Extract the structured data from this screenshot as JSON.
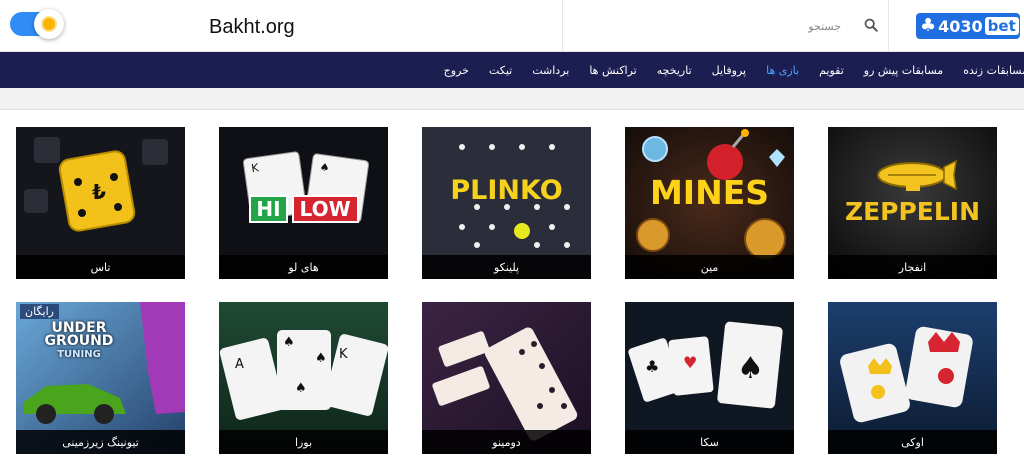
{
  "header": {
    "site_name": "Bakht.org",
    "search_placeholder": "جستجو",
    "logo_number": "4030",
    "logo_word": "bet",
    "logo_symbol": "♣"
  },
  "nav": {
    "items": [
      {
        "label": "مسابقات زنده",
        "active": false
      },
      {
        "label": "مسابقات پیش رو",
        "active": false
      },
      {
        "label": "تقویم",
        "active": false
      },
      {
        "label": "بازی ها",
        "active": true
      },
      {
        "label": "پروفایل",
        "active": false
      },
      {
        "label": "تاریخچه",
        "active": false
      },
      {
        "label": "تراکنش ها",
        "active": false
      },
      {
        "label": "برداشت",
        "active": false
      },
      {
        "label": "تیکت",
        "active": false
      },
      {
        "label": "خروج",
        "active": false
      }
    ]
  },
  "games": {
    "row1": [
      {
        "label": "انفجار",
        "title": "ZEPPELIN",
        "icon": "zeppelin-icon"
      },
      {
        "label": "مین",
        "title": "MINES",
        "icon": "bomb-icon"
      },
      {
        "label": "پلینکو",
        "title": "PLINKO",
        "icon": "plinko-icon"
      },
      {
        "label": "های لو",
        "title_hi": "HI",
        "title_lo": "LOW",
        "icon": "cards-icon"
      },
      {
        "label": "تاس",
        "icon": "dice-icon"
      }
    ],
    "row2": [
      {
        "label": "اوکی",
        "icon": "joker-cards-icon"
      },
      {
        "label": "سکا",
        "icon": "playing-cards-icon"
      },
      {
        "label": "دومینو",
        "icon": "domino-icon"
      },
      {
        "label": "بورا",
        "icon": "playing-cards-icon"
      },
      {
        "label": "تیونینگ زیرزمینی",
        "badge": "رایگان",
        "title_1": "UNDER",
        "title_2": "GROUND",
        "title_3": "TUNING",
        "icon": "car-icon"
      }
    ]
  },
  "colors": {
    "nav_bg": "#1c1e52",
    "accent": "#4aa8ff",
    "toggle": "#2f8df5",
    "brand_blue": "#1f6fe0"
  }
}
